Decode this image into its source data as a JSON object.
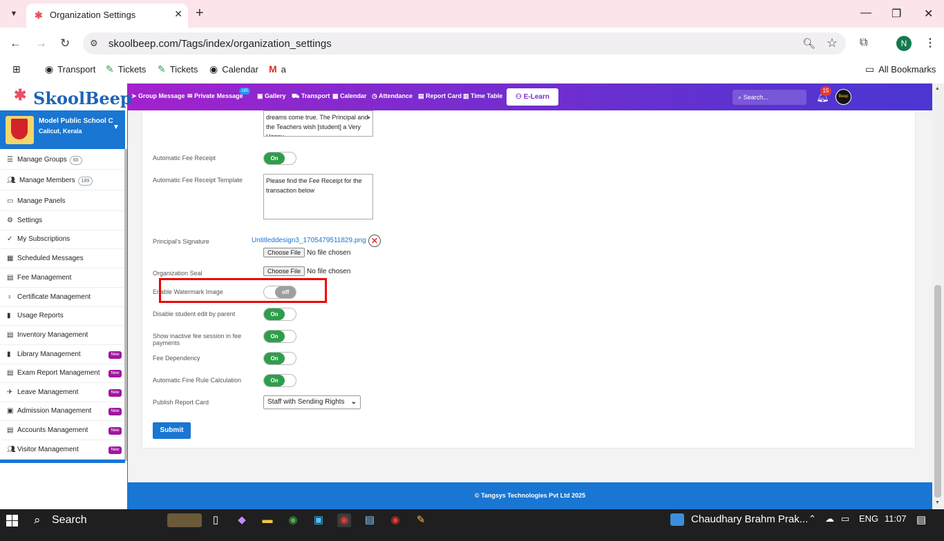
{
  "browser": {
    "tab_title": "Organization Settings",
    "url": "skoolbeep.com/Tags/index/organization_settings",
    "profile_initial": "N",
    "bookmarks": [
      "Transport",
      "Tickets",
      "Tickets",
      "Calendar",
      "a"
    ],
    "all_bookmarks_label": "All Bookmarks"
  },
  "app": {
    "logo_text": "SkoolBeep",
    "nav": {
      "group_message": "Group Message",
      "private_message": "Private Message",
      "private_message_badge": "180",
      "gallery": "Gallery",
      "transport": "Transport",
      "calendar": "Calendar",
      "attendance": "Attendance",
      "report_card": "Report Card",
      "time_table": "Time Table",
      "elearn": "E-Learn"
    },
    "search_placeholder": "Search...",
    "notif_count": "15",
    "avatar_text": "Beep",
    "brand_colors": {
      "gradient_start": "#b31ecc",
      "gradient_end": "#4a36d1",
      "primary": "#1976d2"
    }
  },
  "sidebar": {
    "school_name": "Model Public School C",
    "school_location": "Calicut, Kerala",
    "items": [
      {
        "label": "Manage Groups",
        "count": "60",
        "icon": "list-icon"
      },
      {
        "label": "Manage Members",
        "count": "189",
        "icon": "users-icon"
      },
      {
        "label": "Manage Panels",
        "icon": "monitor-icon"
      },
      {
        "label": "Settings",
        "icon": "gear-icon"
      },
      {
        "label": "My Subscriptions",
        "icon": "check-icon"
      },
      {
        "label": "Scheduled Messages",
        "icon": "calendar-icon"
      },
      {
        "label": "Fee Management",
        "icon": "document-icon"
      },
      {
        "label": "Certificate Management",
        "icon": "certificate-icon"
      },
      {
        "label": "Usage Reports",
        "icon": "bar-chart-icon"
      },
      {
        "label": "Inventory Management",
        "icon": "inventory-icon"
      },
      {
        "label": "Library Management",
        "badge": "New",
        "icon": "book-icon"
      },
      {
        "label": "Exam Report Management",
        "badge": "New",
        "icon": "report-icon"
      },
      {
        "label": "Leave Management",
        "badge": "New",
        "icon": "leave-icon"
      },
      {
        "label": "Admission Management",
        "badge": "New",
        "icon": "admission-icon"
      },
      {
        "label": "Accounts Management",
        "badge": "New",
        "icon": "accounts-icon"
      },
      {
        "label": "Visitor Management",
        "badge": "New",
        "icon": "visitors-icon"
      }
    ]
  },
  "form": {
    "birthday_text": "dreams come true. The Principal and the Teachers wish [student] a Very Happy",
    "auto_fee_receipt_label": "Automatic Fee Receipt",
    "auto_fee_receipt_state": "On",
    "auto_fee_template_label": "Automatic Fee Receipt Template",
    "auto_fee_template_value": "Please find the Fee Receipt for the transaction below",
    "principal_signature_label": "Principal's Signature",
    "principal_signature_file": "Untitleddesign3_1705479511829.png",
    "choose_file_label": "Choose File",
    "no_file_label": "No file chosen",
    "org_seal_label": "Organization Seal",
    "watermark_label": "Enable Watermark Image",
    "watermark_state": "off",
    "disable_edit_label": "Disable student edit by parent",
    "disable_edit_state": "On",
    "inactive_fee_label_1": "Show inactive fee session in fee",
    "inactive_fee_label_2": "payments",
    "inactive_fee_state": "On",
    "fee_dependency_label": "Fee Dependency",
    "fee_dependency_state": "On",
    "fine_rule_label": "Automatic Fine Rule Calculation",
    "fine_rule_state": "On",
    "publish_report_label": "Publish Report Card",
    "publish_report_value": "Staff with Sending Rights",
    "submit_label": "Submit"
  },
  "footer": "© Tangsys Technologies Pvt Ltd 2025",
  "taskbar": {
    "search_label": "Search",
    "user_label": "Chaudhary Brahm Prak...",
    "lang": "ENG",
    "time": "11:07"
  }
}
